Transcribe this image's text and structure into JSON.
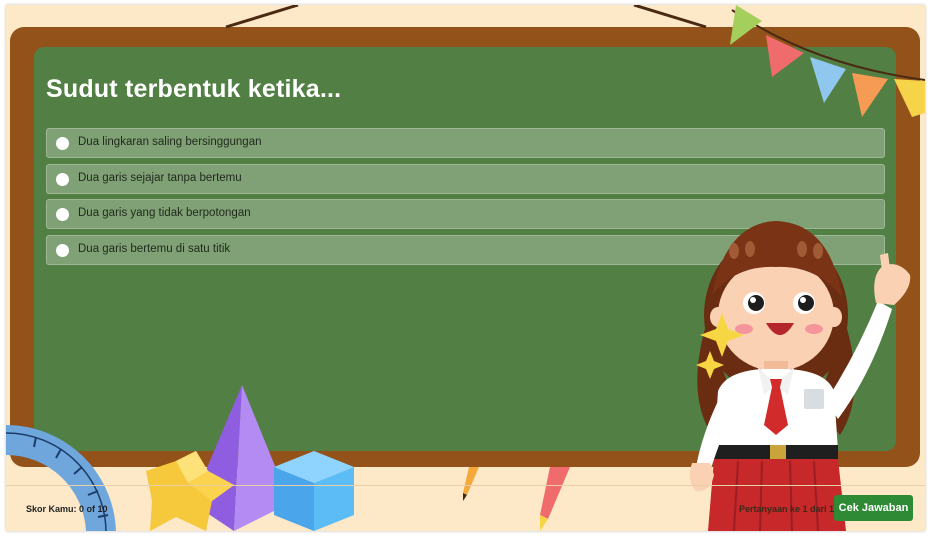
{
  "quiz": {
    "question": "Sudut terbentuk ketika...",
    "options": [
      {
        "label": "Dua lingkaran saling bersinggungan",
        "selected": false
      },
      {
        "label": "Dua garis sejajar tanpa bertemu",
        "selected": false
      },
      {
        "label": "Dua garis yang tidak berpotongan",
        "selected": false
      },
      {
        "label": "Dua garis bertemu di satu titik",
        "selected": false
      }
    ]
  },
  "footer": {
    "score_text": "Skor Kamu: 0 of 10",
    "progress_text": "Pertanyaan ke 1 dari 1",
    "check_button": "Cek Jawaban"
  },
  "colors": {
    "board": "#527f43",
    "frame": "#93521a",
    "background": "#fde8c8",
    "option": "#80a075",
    "button": "#2f8a36"
  },
  "icons": [
    "bunting-flags-decoration",
    "girl-student-illustration",
    "protractor-icon",
    "pyramid-icon",
    "cube-icon",
    "star-shape-icon",
    "pencil-icon"
  ]
}
